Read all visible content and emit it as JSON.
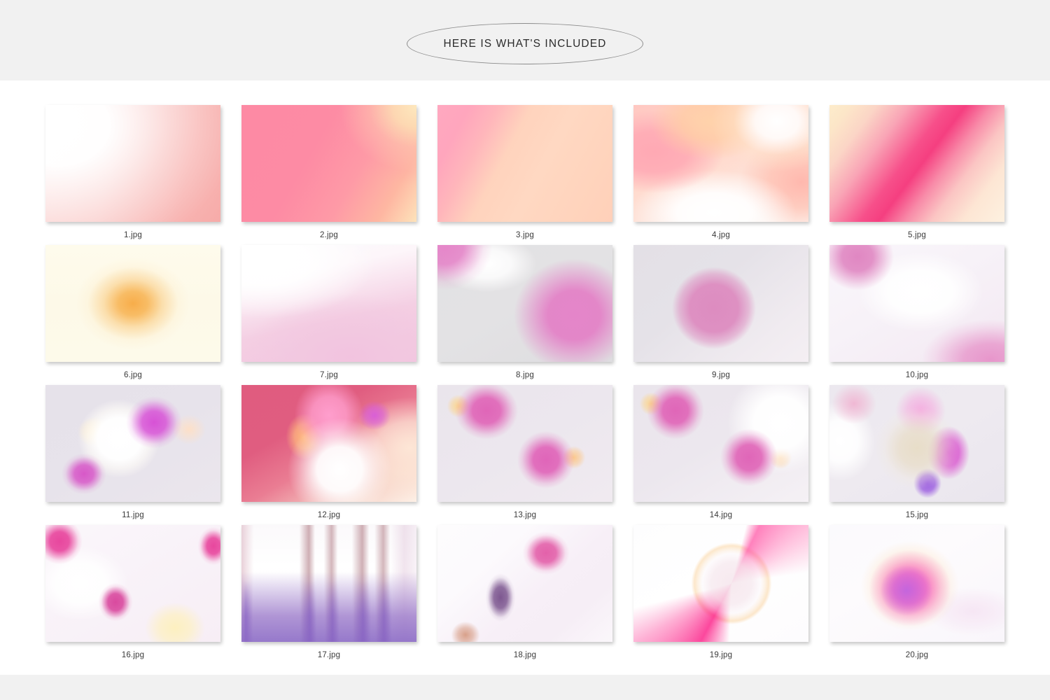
{
  "header": {
    "title": "HERE IS WHAT'S INCLUDED",
    "band_color": "#f1f1f1",
    "pill_border_color": "#8c8c8c",
    "text_color": "#2b2b2b"
  },
  "footer": {
    "band_color": "#f1f1f1"
  },
  "gallery": {
    "columns": 5,
    "rows": 4,
    "count": 20,
    "items": [
      {
        "label": "1.jpg",
        "description": "soft white-to-salmon-pink linear gradient, light at upper left"
      },
      {
        "label": "2.jpg",
        "description": "bright pink field with cream and peach glow in the top-right corner"
      },
      {
        "label": "3.jpg",
        "description": "diagonal gradient from pink on the left to peach on the right"
      },
      {
        "label": "4.jpg",
        "description": "swirled pastel blend of pink, peach and white"
      },
      {
        "label": "5.jpg",
        "description": "diagonal hot-pink band across cream corners"
      },
      {
        "label": "6.jpg",
        "description": "warm orange radial glow centered on cream background"
      },
      {
        "label": "7.jpg",
        "description": "white top fading into soft lilac-pink at the bottom"
      },
      {
        "label": "8.jpg",
        "description": "grey background with large magenta circle right and pink corner top-left"
      },
      {
        "label": "9.jpg",
        "description": "grey-lavender background with a centered soft pink circle"
      },
      {
        "label": "10.jpg",
        "description": "white field with pink blobs at top-left and bottom-right"
      },
      {
        "label": "11.jpg",
        "description": "lavender-grey with a white orb and magenta accents"
      },
      {
        "label": "12.jpg",
        "description": "rose background with a luminous white, peach and violet orb"
      },
      {
        "label": "13.jpg",
        "description": "two magenta blobs floating on pale lilac"
      },
      {
        "label": "14.jpg",
        "description": "two magenta blobs with a bright white glow on the right"
      },
      {
        "label": "15.jpg",
        "description": "soft orb with tan core and magenta-violet right edge"
      },
      {
        "label": "16.jpg",
        "description": "scattered pink blobs and pale yellow glow on white"
      },
      {
        "label": "17.jpg",
        "description": "vertical purple and mauve blurred streaks on white"
      },
      {
        "label": "18.jpg",
        "description": "diagonal pink and purple blurred streak on white"
      },
      {
        "label": "19.jpg",
        "description": "circular orb with hot pink triangular wedges on white"
      },
      {
        "label": "20.jpg",
        "description": "centered magenta and violet radial orb on white"
      }
    ]
  }
}
